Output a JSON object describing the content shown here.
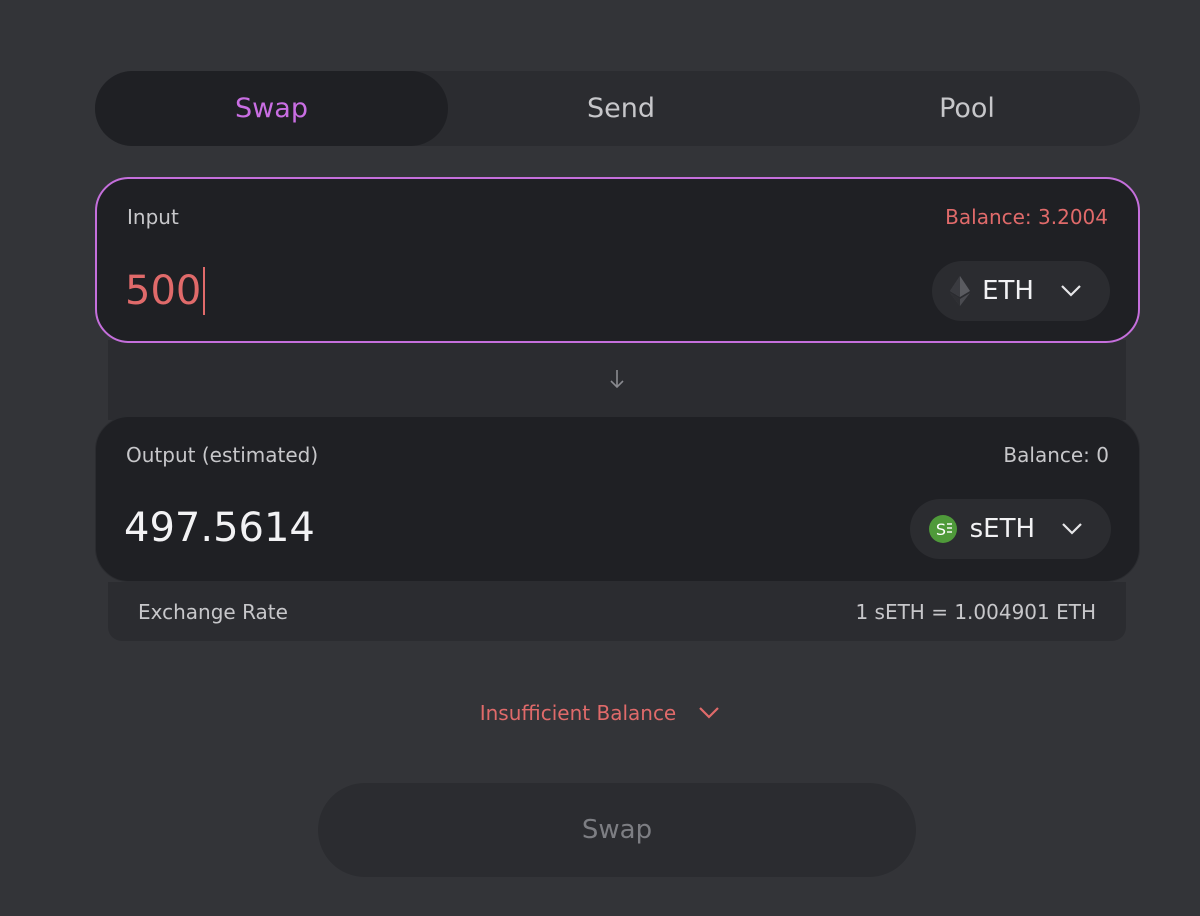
{
  "tabs": [
    {
      "label": "Swap",
      "active": true
    },
    {
      "label": "Send",
      "active": false
    },
    {
      "label": "Pool",
      "active": false
    }
  ],
  "input": {
    "label": "Input",
    "balance": "Balance: 3.2004",
    "amount": "500",
    "token": {
      "symbol": "ETH",
      "icon": "eth-icon"
    }
  },
  "output": {
    "label": "Output (estimated)",
    "balance": "Balance: 0",
    "amount": "497.5614",
    "token": {
      "symbol": "sETH",
      "icon": "seth-icon"
    }
  },
  "exchange": {
    "label": "Exchange Rate",
    "value": "1 sETH = 1.004901 ETH"
  },
  "error": {
    "message": "Insufficient Balance"
  },
  "action": {
    "swap_label": "Swap"
  },
  "colors": {
    "accent": "#c96ee3",
    "error": "#e06a6a",
    "seth_green": "#4f9a3a"
  }
}
